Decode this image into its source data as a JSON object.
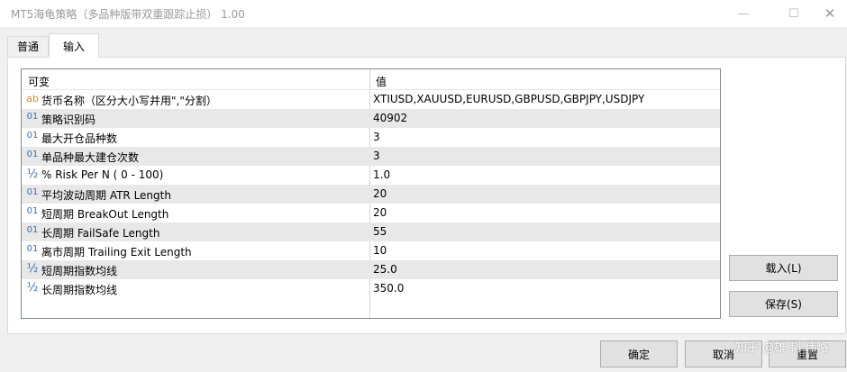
{
  "window": {
    "title": "MT5海龟策略（多品种版带双重跟踪止损） 1.00",
    "minimize": "—",
    "maximize": "☐",
    "close": "✕"
  },
  "tabs": [
    {
      "label": "普通",
      "active": false
    },
    {
      "label": "输入",
      "active": true
    }
  ],
  "grid": {
    "columns": [
      "可变",
      "值"
    ],
    "rows": [
      {
        "icon": "ab",
        "name": "货币名称（区分大小写并用\",\"分割）",
        "value": "XTIUSD,XAUUSD,EURUSD,GBPUSD,GBPJPY,USDJPY"
      },
      {
        "icon": "01",
        "name": "策略识别码",
        "value": "40902"
      },
      {
        "icon": "01",
        "name": "最大开仓品种数",
        "value": "3"
      },
      {
        "icon": "01",
        "name": "单品种最大建仓次数",
        "value": "3"
      },
      {
        "icon": "½",
        "name": "% Risk Per N ( 0 - 100)",
        "value": "1.0"
      },
      {
        "icon": "01",
        "name": "平均波动周期 ATR Length",
        "value": "20"
      },
      {
        "icon": "01",
        "name": "短周期 BreakOut Length",
        "value": "20"
      },
      {
        "icon": "01",
        "name": "长周期 FailSafe Length",
        "value": "55"
      },
      {
        "icon": "01",
        "name": "离市周期 Trailing Exit Length",
        "value": "10"
      },
      {
        "icon": "½",
        "name": "短周期指数均线",
        "value": "25.0"
      },
      {
        "icon": "½",
        "name": "长周期指数均线",
        "value": "350.0"
      }
    ]
  },
  "buttons": {
    "load": "载入(L)",
    "save": "保存(S)",
    "ok": "确定",
    "cancel": "取消",
    "reset": "重置"
  },
  "watermark": "知乎 @雄 韬 伟略",
  "colors": {
    "icon_int": "#3d6fb5",
    "icon_string": "#c8902a",
    "row_alt": "#e8e8e8"
  }
}
